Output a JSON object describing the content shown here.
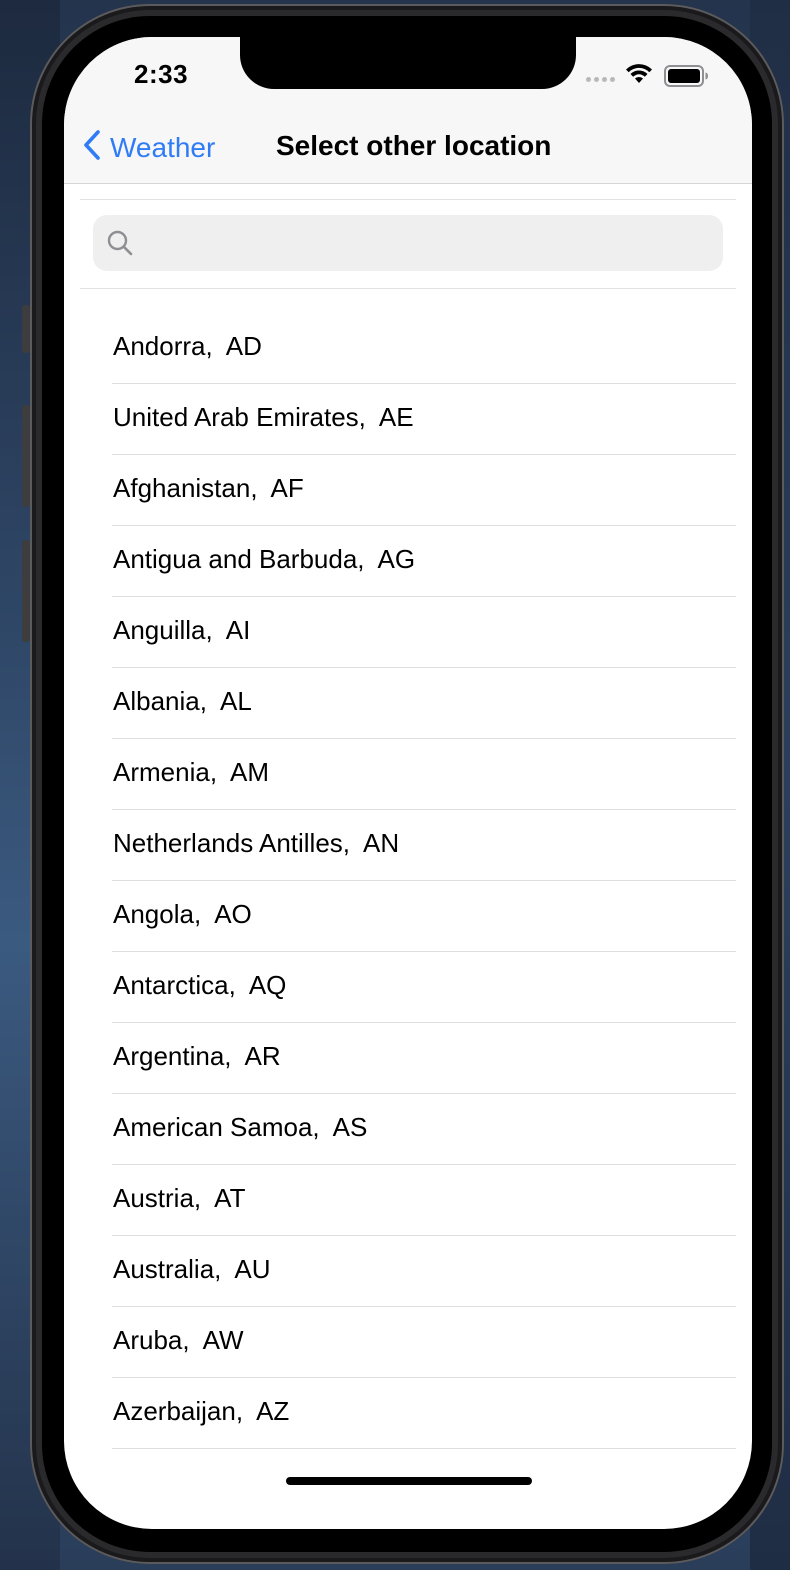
{
  "status_bar": {
    "time": "2:33",
    "icons": [
      "cellular-dots-icon",
      "wifi-icon",
      "battery-icon"
    ]
  },
  "nav_bar": {
    "back_label": "Weather",
    "back_icon": "chevron-left-icon",
    "title": "Select other location"
  },
  "search": {
    "icon": "search-icon",
    "placeholder": "",
    "value": ""
  },
  "locations": [
    {
      "label": "Andorra,  AD"
    },
    {
      "label": "United Arab Emirates,  AE"
    },
    {
      "label": "Afghanistan,  AF"
    },
    {
      "label": "Antigua and Barbuda,  AG"
    },
    {
      "label": "Anguilla,  AI"
    },
    {
      "label": "Albania,  AL"
    },
    {
      "label": "Armenia,  AM"
    },
    {
      "label": "Netherlands Antilles,  AN"
    },
    {
      "label": "Angola,  AO"
    },
    {
      "label": "Antarctica,  AQ"
    },
    {
      "label": "Argentina,  AR"
    },
    {
      "label": "American Samoa,  AS"
    },
    {
      "label": "Austria,  AT"
    },
    {
      "label": "Australia,  AU"
    },
    {
      "label": "Aruba,  AW"
    },
    {
      "label": "Azerbaijan,  AZ"
    }
  ],
  "colors": {
    "accent": "#2F7CF6",
    "nav_background": "#F7F7F7",
    "search_background": "#EFEFEF",
    "separator": "#DEDEE0"
  }
}
